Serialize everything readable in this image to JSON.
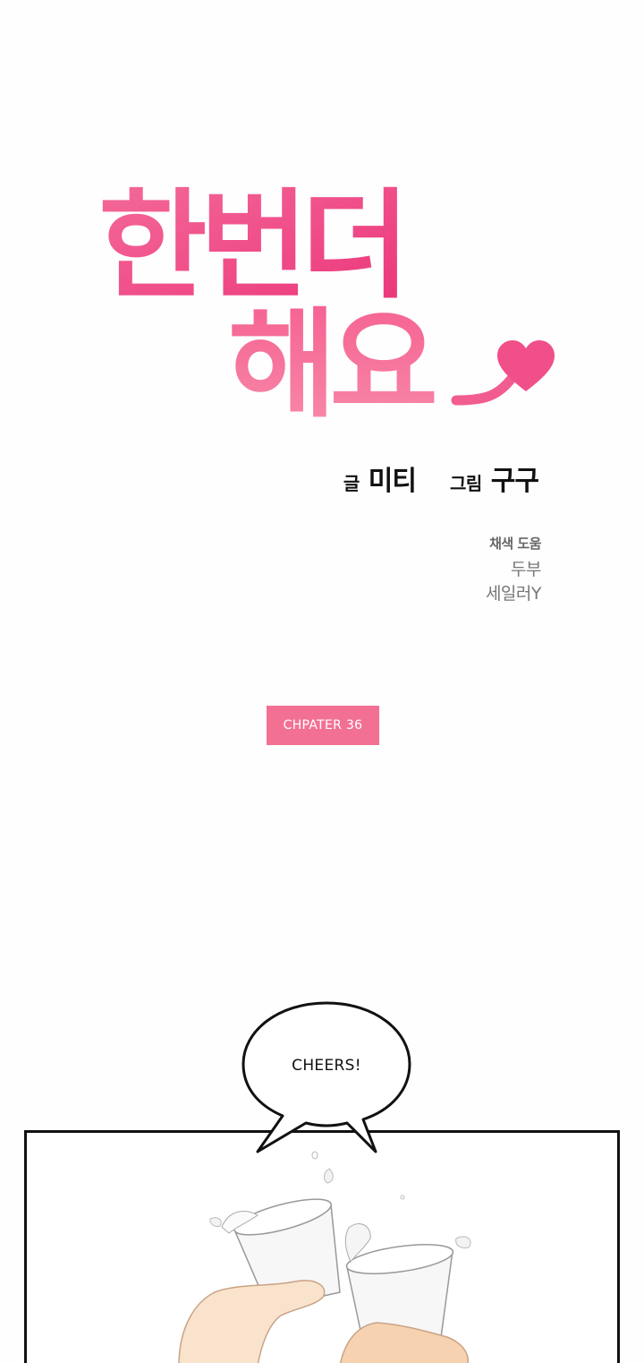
{
  "title": {
    "line1": "한번더",
    "line2": "해요"
  },
  "colors": {
    "logo_top": "#f04f8a",
    "logo_bottom": "#f77aa0",
    "badge": "#f27193",
    "background": "#fefefe"
  },
  "credits": {
    "writer_role": "글",
    "writer_name": "미티",
    "artist_role": "그림",
    "artist_name": "구구"
  },
  "assist": {
    "title": "채색 도움",
    "names": [
      "두부",
      "세일러Y"
    ]
  },
  "chapter": {
    "label": "CHPATER 36"
  },
  "bubble": {
    "text": "CHEERS!"
  },
  "icons": [
    "heart-icon"
  ]
}
